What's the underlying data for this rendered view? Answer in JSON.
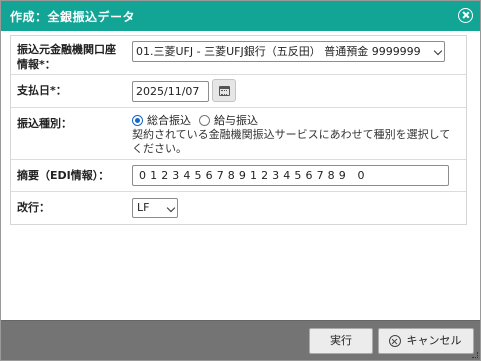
{
  "dialog": {
    "title": "作成：全銀振込データ"
  },
  "form": {
    "account": {
      "label_line1": "振込元金融機関口座",
      "label_line2": "情報*：",
      "selected": "01.三菱UFJ - 三菱UFJ銀行（五反田） 普通預金 9999999"
    },
    "payment_date": {
      "label": "支払日*：",
      "value": "2025/11/07"
    },
    "transfer_type": {
      "label": "振込種別：",
      "options": [
        {
          "label": "総合振込",
          "checked": true
        },
        {
          "label": "給与振込",
          "checked": false
        }
      ],
      "note": "契約されている金融機関振込サービスにあわせて種別を選択してください。"
    },
    "edi": {
      "label": "摘要（EDI情報）：",
      "value": "0123456789123456789 0"
    },
    "newline": {
      "label": "改行：",
      "selected": "LF"
    }
  },
  "footer": {
    "run_label": "実行",
    "cancel_label": "キャンセル"
  },
  "colors": {
    "titlebar": "#12a596",
    "footer": "#747474",
    "radio_accent": "#1766c7"
  }
}
